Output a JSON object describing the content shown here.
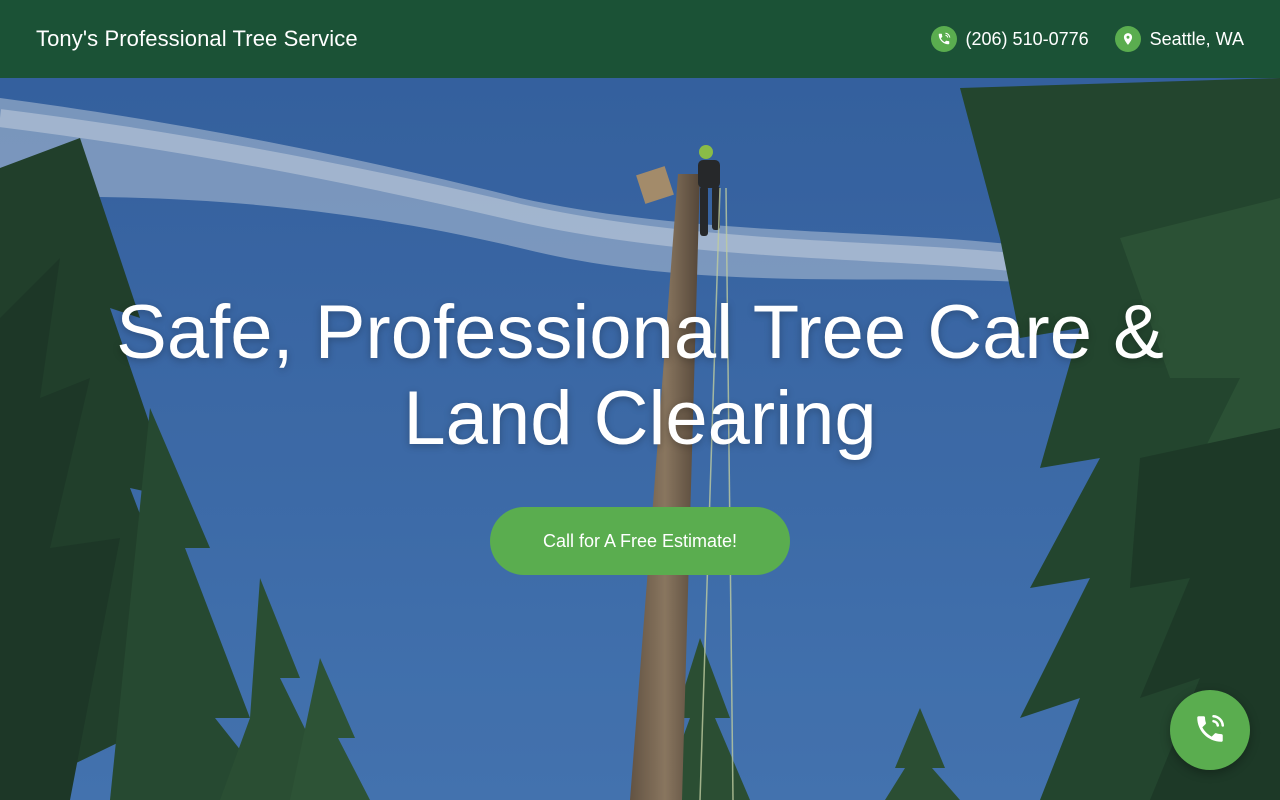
{
  "header": {
    "brand": "Tony's Professional Tree Service",
    "phone": "(206) 510-0776",
    "location": "Seattle, WA",
    "phone_icon": "phone-icon",
    "location_icon": "map-pin-icon"
  },
  "hero": {
    "headline_line1": "Safe, Professional Tree Care &",
    "headline_line2": "Land Clearing",
    "cta_label": "Call for A Free Estimate!"
  },
  "floating_call": {
    "icon": "phone-ringing-icon"
  },
  "colors": {
    "header_bg": "#1b5236",
    "accent_green": "#5aad4f",
    "sky_blue": "#3f6fb0",
    "text_white": "#ffffff"
  }
}
